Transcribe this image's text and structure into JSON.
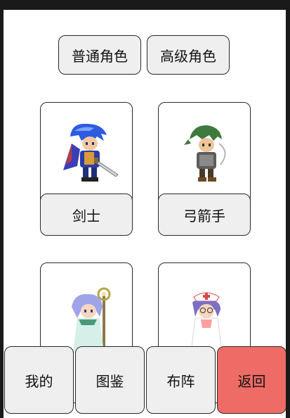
{
  "tabs": {
    "normal_label": "普通角色",
    "advanced_label": "高级角色"
  },
  "characters": [
    {
      "label": "剑士",
      "icon": "swordsman-sprite"
    },
    {
      "label": "弓箭手",
      "icon": "archer-sprite"
    },
    {
      "label": "",
      "icon": "mage-sprite"
    },
    {
      "label": "",
      "icon": "nurse-sprite"
    }
  ],
  "bottom_nav": {
    "mine_label": "我的",
    "codex_label": "图鉴",
    "formation_label": "布阵",
    "back_label": "返回"
  },
  "colors": {
    "back_button": "#ee6b66",
    "button_bg": "#efefef"
  }
}
